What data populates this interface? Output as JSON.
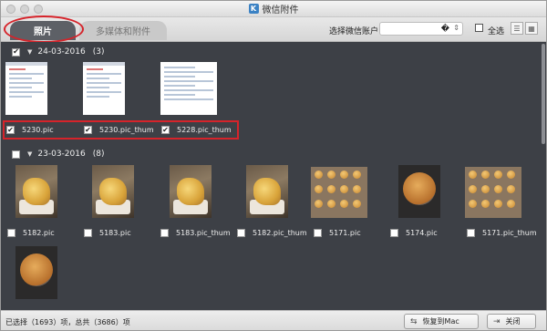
{
  "window": {
    "title": "微信附件",
    "app_icon": "K"
  },
  "tabs": {
    "photos": "照片",
    "media": "多媒体和附件"
  },
  "account": {
    "label": "选择微信账户",
    "value": "�",
    "select_all": "全选"
  },
  "groups": [
    {
      "date": "24-03-2016",
      "count": "(3)",
      "checked": true,
      "items": [
        {
          "name": "5230.pic",
          "checked": true,
          "thumb": "screenshot"
        },
        {
          "name": "5230.pic_thum",
          "checked": true,
          "thumb": "screenshot"
        },
        {
          "name": "5228.pic_thum",
          "checked": true,
          "thumb": "screenshot-chat"
        }
      ]
    },
    {
      "date": "23-03-2016",
      "count": "(8)",
      "checked": false,
      "items": [
        {
          "name": "5182.pic",
          "checked": false,
          "thumb": "cake-slice"
        },
        {
          "name": "5183.pic",
          "checked": false,
          "thumb": "cake-slice"
        },
        {
          "name": "5183.pic_thum",
          "checked": false,
          "thumb": "cake-slice"
        },
        {
          "name": "5182.pic_thum",
          "checked": false,
          "thumb": "cake-slice"
        },
        {
          "name": "5171.pic",
          "checked": false,
          "thumb": "muffin-tray"
        },
        {
          "name": "5174.pic",
          "checked": false,
          "thumb": "round-cake"
        },
        {
          "name": "5171.pic_thum",
          "checked": false,
          "thumb": "muffin-tray"
        },
        {
          "name": "",
          "checked": false,
          "thumb": "round-cake"
        }
      ]
    }
  ],
  "footer": {
    "status": "已选择（1693）项，总共（3686）项",
    "restore": "恢复到Mac",
    "close": "关闭"
  },
  "colors": {
    "content_bg": "#3d4046",
    "highlight": "#d6232a",
    "active_tab": "#5d6066"
  }
}
